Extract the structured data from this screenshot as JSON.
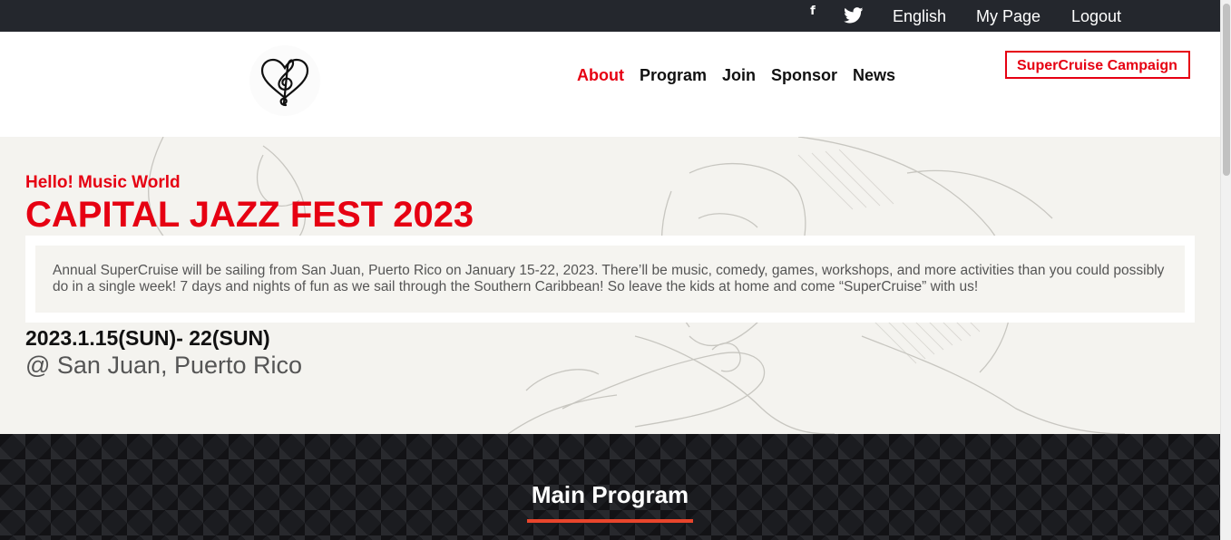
{
  "topbar": {
    "facebook_icon": "facebook-icon",
    "twitter_icon": "twitter-icon",
    "language": "English",
    "my_page": "My Page",
    "logout": "Logout"
  },
  "header": {
    "logo_icon": "treble-clef-heart-icon",
    "nav": [
      {
        "label": "About",
        "active": true
      },
      {
        "label": "Program",
        "active": false
      },
      {
        "label": "Join",
        "active": false
      },
      {
        "label": "Sponsor",
        "active": false
      },
      {
        "label": "News",
        "active": false
      }
    ],
    "campaign_label": "SuperCruise Campaign"
  },
  "hero": {
    "greeting": "Hello! Music World",
    "title": "CAPITAL JAZZ FEST 2023",
    "description": "Annual SuperCruise will be sailing from San Juan, Puerto Rico on January 15-22, 2023. There’ll be music, comedy, games, workshops, and more activities than you could possibly do in a single week! 7 days and nights of fun as we sail through the Southern Caribbean! So leave the kids at home and come “SuperCruise” with us!",
    "dates": "2023.1.15(SUN)- 22(SUN)",
    "venue": "@ San Juan, Puerto Rico"
  },
  "program": {
    "title": "Main Program"
  },
  "colors": {
    "accent": "#e60012",
    "topbar": "#24272d",
    "hero_bg": "#f4f3ef",
    "program_bg": "#1b1c20",
    "underline": "#e8452c"
  }
}
